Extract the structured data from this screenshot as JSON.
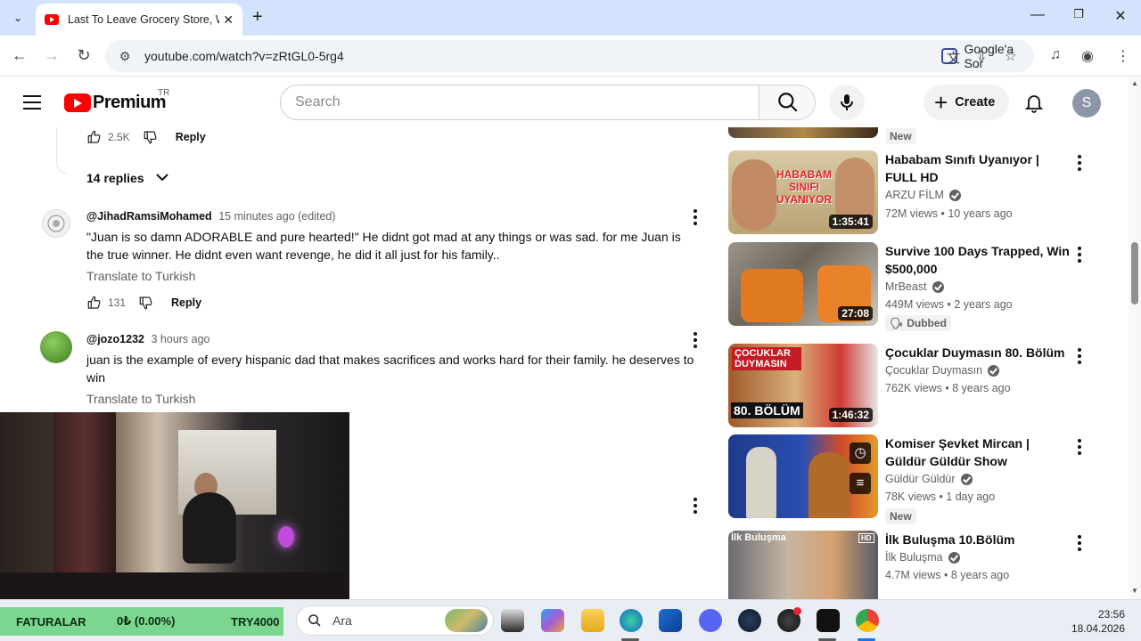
{
  "browser": {
    "tab_title": "Last To Leave Grocery Store, Wi",
    "url": "youtube.com/watch?v=zRtGL0-5rg4",
    "google_sor": "Google'a Sor"
  },
  "header": {
    "logo_text": "Premium",
    "region": "TR",
    "search_placeholder": "Search",
    "create_label": "Create",
    "avatar_letter": "S"
  },
  "comments": {
    "prev_like_count": "2.5K",
    "prev_reply_label": "Reply",
    "replies_label": "14 replies",
    "items": [
      {
        "author": "@JihadRamsiMohamed",
        "time": "15 minutes ago (edited)",
        "text": "\"Juan is so damn ADORABLE and pure hearted!\" He didnt got mad at any things or was sad. for me Juan is the true winner. He didnt even want revenge, he did it all just for his family..",
        "translate": "Translate to Turkish",
        "likes": "131",
        "reply": "Reply"
      },
      {
        "author": "@jozo1232",
        "time": "3 hours ago",
        "text": "juan is the example of every hispanic dad that makes sacrifices and works hard for their family. he deserves to win",
        "translate": "Translate to Turkish"
      }
    ]
  },
  "sidebar": {
    "top_partial": {
      "badge": "New"
    },
    "videos": [
      {
        "title": "Hababam Sınıfı Uyanıyor | FULL HD",
        "channel": "ARZU FİLM",
        "meta": "72M views • 10 years ago",
        "duration": "1:35:41",
        "thumb_text": "HABABAM SINIFI UYANIYOR"
      },
      {
        "title": "Survive 100 Days Trapped, Win $500,000",
        "channel": "MrBeast",
        "meta": "449M views • 2 years ago",
        "duration": "27:08",
        "badge": "Dubbed"
      },
      {
        "title": "Çocuklar Duymasın 80. Bölüm",
        "channel": "Çocuklar Duymasın",
        "meta": "762K views • 8 years ago",
        "duration": "1:46:32",
        "thumb_text": "80. BÖLÜM",
        "thumb_text2": "ÇOCUKLAR DUYMASIN"
      },
      {
        "title": "Komiser Şevket Mircan | Güldür Güldür Show",
        "channel": "Güldür Güldür",
        "meta": "78K views • 1 day ago",
        "badge": "New"
      },
      {
        "title": "İlk Buluşma 10.Bölüm",
        "channel": "İlk Buluşma",
        "meta": "4.7M views • 8 years ago",
        "thumb_text": "İlk Buluşma"
      }
    ]
  },
  "taskbar": {
    "ticker_name": "FATURALAR",
    "ticker_value": "0₺ (0.00%)",
    "ticker_pair": "TRY4000",
    "search_placeholder": "Ara",
    "time": "23:56",
    "date": "18.04.2026"
  },
  "colors": {
    "brand_red": "#ff0000",
    "ticker_green": "#7bd68f",
    "tab_strip": "#d3e3fd"
  }
}
